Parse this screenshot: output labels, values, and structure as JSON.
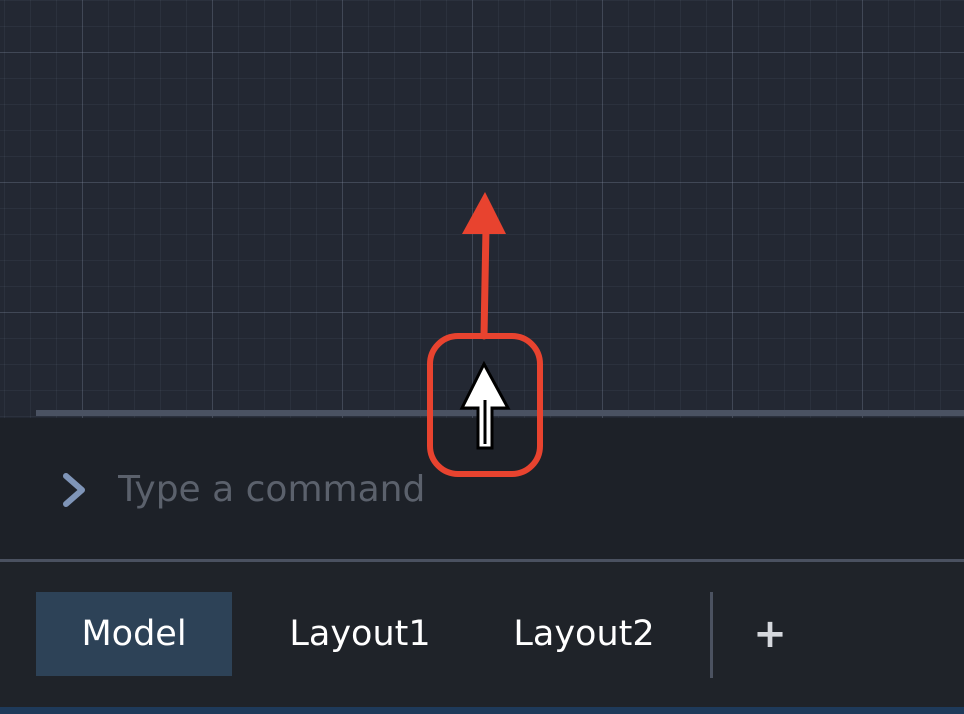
{
  "command_line": {
    "placeholder": "Type a command",
    "value": "",
    "prompt_icon": "chevron-right-icon"
  },
  "layout_tabs": {
    "items": [
      {
        "label": "Model",
        "active": true
      },
      {
        "label": "Layout1",
        "active": false
      },
      {
        "label": "Layout2",
        "active": false
      }
    ],
    "add_label": "+"
  },
  "annotation": {
    "arrow_icon": "up-arrow-annotation",
    "highlight_icon": "rounded-highlight-box",
    "cursor_icon": "resize-cursor-icon",
    "color": "#e8432f"
  },
  "colors": {
    "canvas_background": "#232833",
    "active_tab": "#2d4257",
    "annotation": "#e8432f"
  }
}
